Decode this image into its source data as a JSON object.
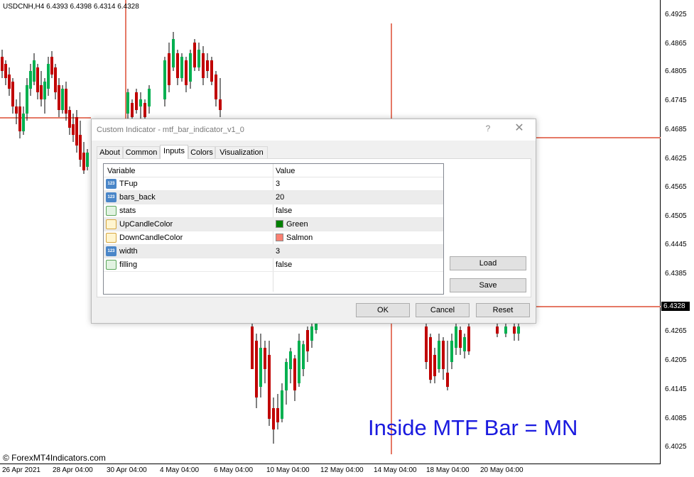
{
  "chart": {
    "symbol_label": "USDCNH,H4  6.4393 6.4398 6.4314 6.4328",
    "price_ticks": [
      "6.4925",
      "6.4865",
      "6.4805",
      "6.4745",
      "6.4685",
      "6.4625",
      "6.4565",
      "6.4505",
      "6.4445",
      "6.4385",
      "6.4265",
      "6.4205",
      "6.4145",
      "6.4085",
      "6.4025"
    ],
    "current_price": "6.4328",
    "time_ticks": [
      "26 Apr 2021",
      "28 Apr 04:00",
      "30 Apr 04:00",
      "4 May 04:00",
      "6 May 04:00",
      "10 May 04:00",
      "12 May 04:00",
      "14 May 04:00",
      "18 May 04:00",
      "20 May 04:00"
    ],
    "watermark": "© ForexMT4Indicators.com",
    "overlay_text": "Inside MTF Bar = MN",
    "colors": {
      "up": "#00b050",
      "down": "#c00000",
      "level": "#e57966"
    }
  },
  "dialog": {
    "title": "Custom Indicator - mtf_bar_indicator_v1_0",
    "help_glyph": "?",
    "close_glyph": "✕",
    "tabs": [
      "About",
      "Common",
      "Inputs",
      "Colors",
      "Visualization"
    ],
    "active_tab": "Inputs",
    "columns": {
      "variable": "Variable",
      "value": "Value"
    },
    "rows": [
      {
        "name": "TFup",
        "value": "3",
        "icon": "number-icon"
      },
      {
        "name": "bars_back",
        "value": "20",
        "icon": "number-icon"
      },
      {
        "name": "stats",
        "value": "false",
        "icon": "boolean-icon"
      },
      {
        "name": "UpCandleColor",
        "value": "Green",
        "icon": "color-icon",
        "swatch": "#008000"
      },
      {
        "name": "DownCandleColor",
        "value": "Salmon",
        "icon": "color-icon",
        "swatch": "#fa8072"
      },
      {
        "name": "width",
        "value": "3",
        "icon": "number-icon"
      },
      {
        "name": "filling",
        "value": "false",
        "icon": "boolean-icon"
      }
    ],
    "buttons": {
      "load": "Load",
      "save": "Save",
      "ok": "OK",
      "cancel": "Cancel",
      "reset": "Reset"
    }
  }
}
